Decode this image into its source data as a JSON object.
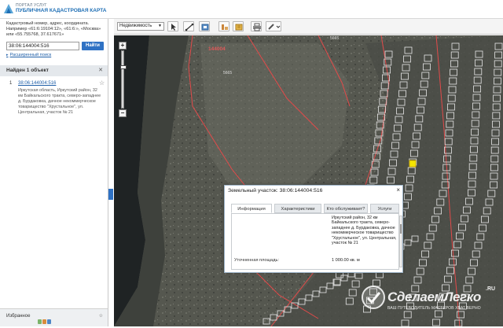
{
  "header": {
    "brand_top": "ПОРТАЛ УСЛУГ",
    "brand_main": "ПУБЛИЧНАЯ КАДАСТРОВАЯ КАРТА",
    "logo_icon": "portal-logo-icon"
  },
  "sidebar": {
    "hint": "Кадастровый номер, адрес, координата. Например «61:6:19104:12», «61:6:», «Москва» или «55.755768, 37.617671»",
    "search_value": "38:06:144004:516",
    "find_label": "Найти",
    "extended_search": "Расширенный поиск",
    "found_title": "Найден 1 объект",
    "results": [
      {
        "num": "1",
        "link": "38:06:144004:516",
        "address": "Иркутская область, Иркутский район, 32 км Байкальского тракта, северо-западнее д. Бурдаковка, дачное некоммерческое товарищество \"Хрустальное\", ул. Центральная, участок № 21"
      }
    ],
    "favorites_label": "Избранное"
  },
  "toolbar": {
    "layer_select": "Недвижимость",
    "tools": [
      "select-tool-icon",
      "measure-tool-icon",
      "layers-icon",
      "identify-icon",
      "bookmark-icon",
      "print-icon",
      "link-icon"
    ]
  },
  "map": {
    "labels": {
      "quarter": "144004",
      "small_a": "5665",
      "small_b": "5665"
    },
    "highlight_color": "#f5e600",
    "boundary_color": "#e24a4a"
  },
  "popup": {
    "title": "Земельный участок: 38:06:144004:516",
    "tabs": [
      "Информация",
      "Характеристики",
      "Кто обслуживает?",
      "Услуги"
    ],
    "active_tab": 0,
    "info_text": "Иркутский район, 32 км Байкальского тракта, северо-западнее д. Бурдаковка, дачное некоммерческое товарищество \"Хрустальное\", ул. Центральная, участок № 21",
    "area_label": "Уточненная площадь:",
    "area_value": "1 000.00 кв. м"
  },
  "watermark": {
    "text": "СделаемЛегко",
    "ru": ".RU",
    "sub": "ВАШ ПУТЕВОДИТЕЛЬ МАСТЕРОВ ХВАТ ВЕРНО"
  }
}
